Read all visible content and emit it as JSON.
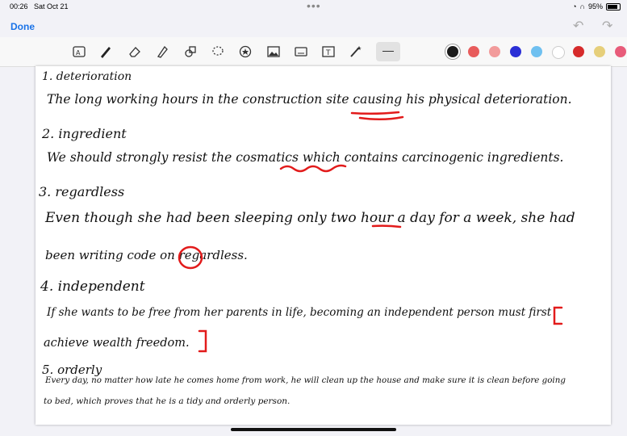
{
  "status": {
    "time": "00:26",
    "date": "Sat Oct 21",
    "battery": "95%"
  },
  "nav": {
    "done": "Done"
  },
  "palette": [
    "#1b1b1b",
    "#e85c5c",
    "#f29b9b",
    "#2b2fd6",
    "#6fc0f0",
    "#ffffff",
    "#d62b2b",
    "#e6cf7a",
    "#e85c7a"
  ],
  "notes": [
    {
      "id": "h1",
      "text": "1. deterioration"
    },
    {
      "id": "s1",
      "text": "The long working hours in the construction site causing his physical deterioration."
    },
    {
      "id": "h2",
      "text": "2. ingredient"
    },
    {
      "id": "s2",
      "text": "We should strongly resist the cosmatics which contains carcinogenic ingredients."
    },
    {
      "id": "h3",
      "text": "3. regardless"
    },
    {
      "id": "s3a",
      "text": "Even though she had been sleeping only two hour a day for a week, she had"
    },
    {
      "id": "s3b",
      "text": "been writing code on regardless."
    },
    {
      "id": "h4",
      "text": "4. independent"
    },
    {
      "id": "s4a",
      "text": "If she wants to be free from her parents in life, becoming an independent person must first"
    },
    {
      "id": "s4b",
      "text": "achieve wealth freedom."
    },
    {
      "id": "h5",
      "text": "5. orderly"
    },
    {
      "id": "s5a",
      "text": "Every day, no matter how late he comes home from work, he will clean up the house and make sure it is clean before going"
    },
    {
      "id": "s5b",
      "text": "to bed, which proves that he is a tidy and orderly person."
    }
  ]
}
